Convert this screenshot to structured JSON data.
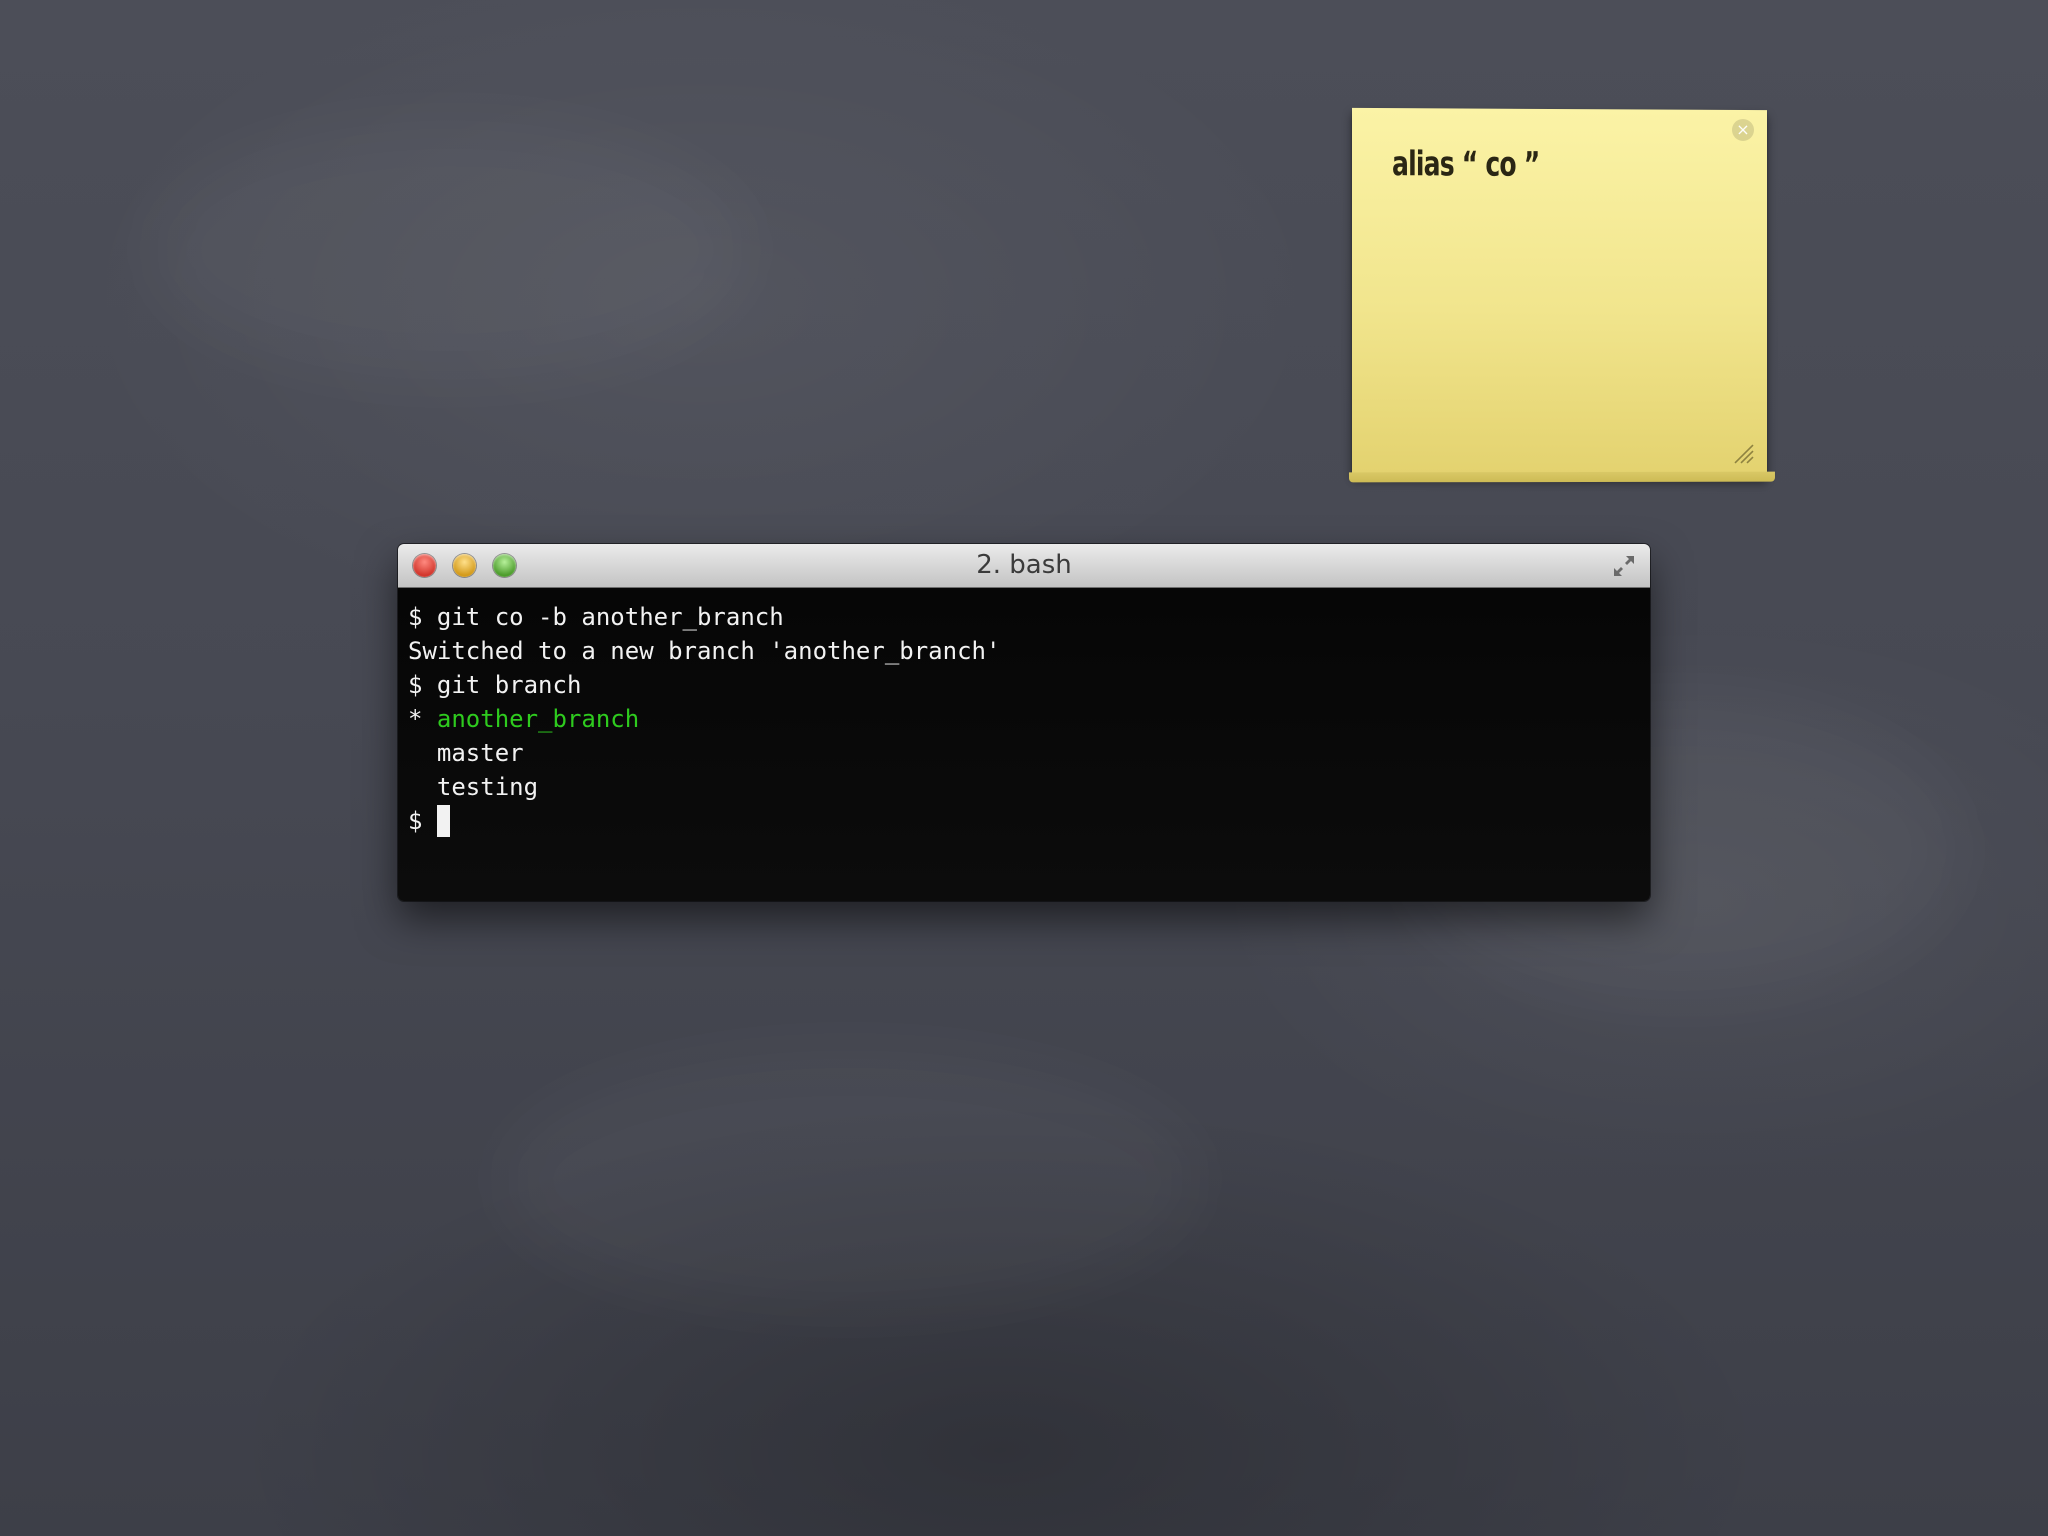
{
  "sticky_note": {
    "text": "alias “ co ”",
    "icons": {
      "close": "close-circle-icon",
      "resize": "resize-grip-icon"
    }
  },
  "terminal": {
    "title": "2. bash",
    "lines": [
      {
        "text": "$ git co -b another_branch"
      },
      {
        "text": "Switched to a new branch 'another_branch'"
      },
      {
        "text": "$ git branch"
      },
      {
        "prefix": "* ",
        "text": "another_branch",
        "color": "#2ecb1e"
      },
      {
        "prefix": "  ",
        "text": "master"
      },
      {
        "prefix": "  ",
        "text": "testing"
      }
    ],
    "prompt": "$ ",
    "icons": {
      "close": "close-button-icon",
      "minimize": "minimize-button-icon",
      "zoom": "zoom-button-icon",
      "fullscreen": "fullscreen-arrows-icon"
    }
  },
  "colors": {
    "background": "#474953",
    "sticky": "#f1e58d",
    "terminal_bg": "#0a0a0a",
    "terminal_text": "#f2f2f2",
    "highlight_branch": "#2ecb1e"
  }
}
